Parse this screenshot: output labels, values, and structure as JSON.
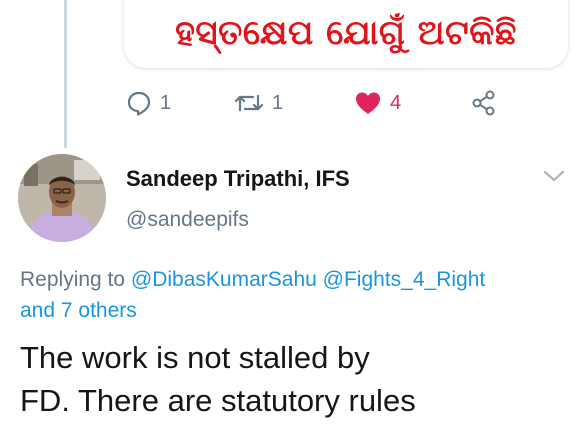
{
  "quoted": {
    "text": "ହସ୍ତକ୍ଷେପ ଯୋଗୁଁ ଅଟକିଛି"
  },
  "actions": {
    "reply_count": "1",
    "retweet_count": "1",
    "like_count": "4"
  },
  "author": {
    "name": "Sandeep Tripathi, IFS",
    "handle": "@sandeepifs"
  },
  "replying": {
    "prefix": "Replying to",
    "mention_1": "@DibasKumarSahu",
    "mention_2": "@Fights_4_Right",
    "others": "and 7 others"
  },
  "tweet": {
    "line_1": "The work is not stalled by",
    "line_2": "FD. There are statutory rules"
  },
  "colors": {
    "accent": "#1b95e0",
    "like": "#e0245e",
    "muted": "#657786",
    "quote_text": "#e0141b"
  },
  "icons": [
    "reply-icon",
    "retweet-icon",
    "heart-icon",
    "share-icon",
    "chevron-down-icon"
  ]
}
